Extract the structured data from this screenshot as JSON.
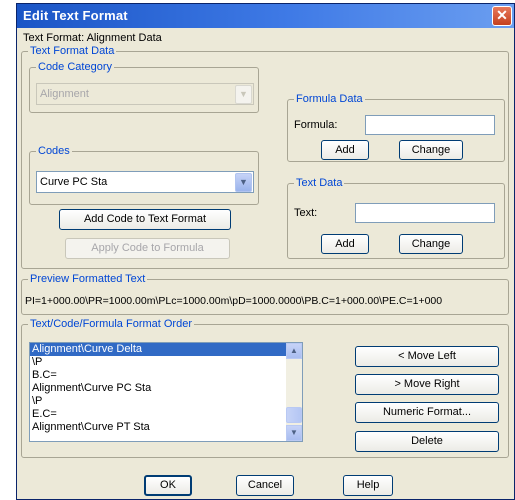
{
  "window": {
    "title": "Edit Text Format",
    "close_glyph": "✕"
  },
  "text_format_label": "Text Format: Alignment Data",
  "text_format_data": {
    "title": "Text Format Data",
    "code_category": {
      "title": "Code Category",
      "value": "Alignment"
    },
    "codes": {
      "title": "Codes",
      "value": "Curve PC Sta"
    },
    "add_code_button": "Add Code to Text Format",
    "apply_code_button": "Apply Code to Formula",
    "formula_data": {
      "title": "Formula Data",
      "formula_label": "Formula:",
      "formula_value": "",
      "add_button": "Add",
      "change_button": "Change"
    },
    "text_data": {
      "title": "Text Data",
      "text_label": "Text:",
      "text_value": "",
      "add_button": "Add",
      "change_button": "Change"
    }
  },
  "preview": {
    "title": "Preview Formatted Text",
    "text": "PI=1+000.00\\PR=1000.00m\\PLc=1000.00m\\pD=1000.0000\\PB.C=1+000.00\\PE.C=1+000"
  },
  "order": {
    "title": "Text/Code/Formula Format Order",
    "items": [
      "Alignment\\Curve Delta",
      "\\P",
      "B.C=",
      "Alignment\\Curve PC Sta",
      "\\P",
      "E.C=",
      "Alignment\\Curve PT Sta"
    ],
    "selected_index": 0,
    "move_left_button": "< Move Left",
    "move_right_button": "> Move Right",
    "numeric_format_button": "Numeric Format...",
    "delete_button": "Delete"
  },
  "footer": {
    "ok_button": "OK",
    "cancel_button": "Cancel",
    "help_button": "Help"
  },
  "colors": {
    "title_bar": "#1a55c6",
    "group_title": "#0046d5",
    "selection": "#316ac5",
    "dialog_bg": "#ece9d8"
  }
}
